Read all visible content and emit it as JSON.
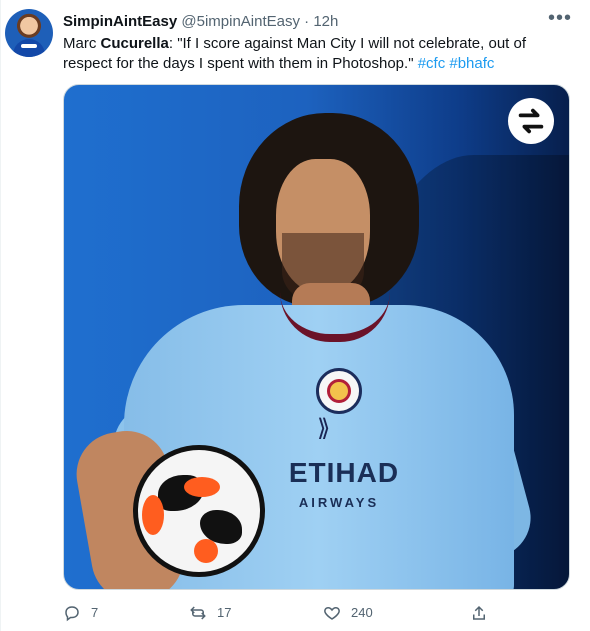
{
  "tweet": {
    "name": "SimpinAintEasy",
    "handle": "@5impinAintEasy",
    "separator": "·",
    "time": "12h",
    "text_prefix": "Marc ",
    "text_bold": "Cucurella",
    "text_body": ": \"If I score against Man City I will not celebrate, out of respect for the days I spent with them in Photoshop.\" ",
    "hashtags": [
      "#cfc",
      "#bhafc"
    ]
  },
  "media": {
    "sponsor": "ETIHAD",
    "sponsor_subtitle": "AIRWAYS"
  },
  "actions": {
    "reply_count": "7",
    "retweet_count": "17",
    "like_count": "240"
  },
  "icons": {
    "more": "more-icon",
    "reply": "reply-icon",
    "retweet": "retweet-icon",
    "like": "like-icon",
    "share": "share-icon",
    "media_logo": "swap-logo-icon"
  },
  "colors": {
    "text": "#0f1419",
    "muted": "#536471",
    "link": "#1d9bf0",
    "border": "#cfd9de"
  }
}
